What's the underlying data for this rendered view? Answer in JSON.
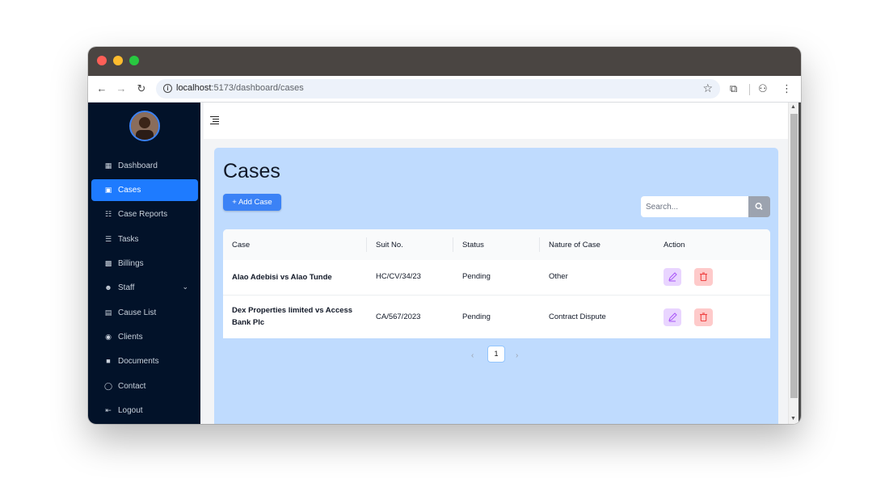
{
  "browser": {
    "url_host": "localhost",
    "url_path": ":5173/dashboard/cases"
  },
  "sidebar": {
    "items": [
      {
        "label": "Dashboard",
        "icon": "dashboard-icon"
      },
      {
        "label": "Cases",
        "icon": "briefcase-icon",
        "active": true
      },
      {
        "label": "Case Reports",
        "icon": "report-icon"
      },
      {
        "label": "Tasks",
        "icon": "list-icon"
      },
      {
        "label": "Billings",
        "icon": "money-icon"
      },
      {
        "label": "Staff",
        "icon": "users-icon"
      },
      {
        "label": "Cause List",
        "icon": "calendar-icon"
      },
      {
        "label": "Clients",
        "icon": "handshake-icon"
      },
      {
        "label": "Documents",
        "icon": "document-icon"
      },
      {
        "label": "Contact",
        "icon": "contact-icon"
      },
      {
        "label": "Logout",
        "icon": "logout-icon"
      }
    ]
  },
  "main": {
    "title": "Cases",
    "add_button": "+ Add Case",
    "search_placeholder": "Search...",
    "table": {
      "headers": [
        "Case",
        "Suit No.",
        "Status",
        "Nature of Case",
        "Action"
      ],
      "rows": [
        {
          "case": "Alao Adebisi vs Alao Tunde",
          "suit_no": "HC/CV/34/23",
          "status": "Pending",
          "nature": "Other"
        },
        {
          "case": "Dex Properties limited vs Access Bank Plc",
          "suit_no": "CA/567/2023",
          "status": "Pending",
          "nature": "Contract Dispute"
        }
      ]
    },
    "pagination": {
      "current_page": "1"
    }
  },
  "colors": {
    "sidebar_bg": "#021229",
    "accent": "#1e7bff",
    "panel_bg": "#bfdbfe",
    "edit_bg": "#e9d5ff",
    "delete_bg": "#fecaca"
  }
}
